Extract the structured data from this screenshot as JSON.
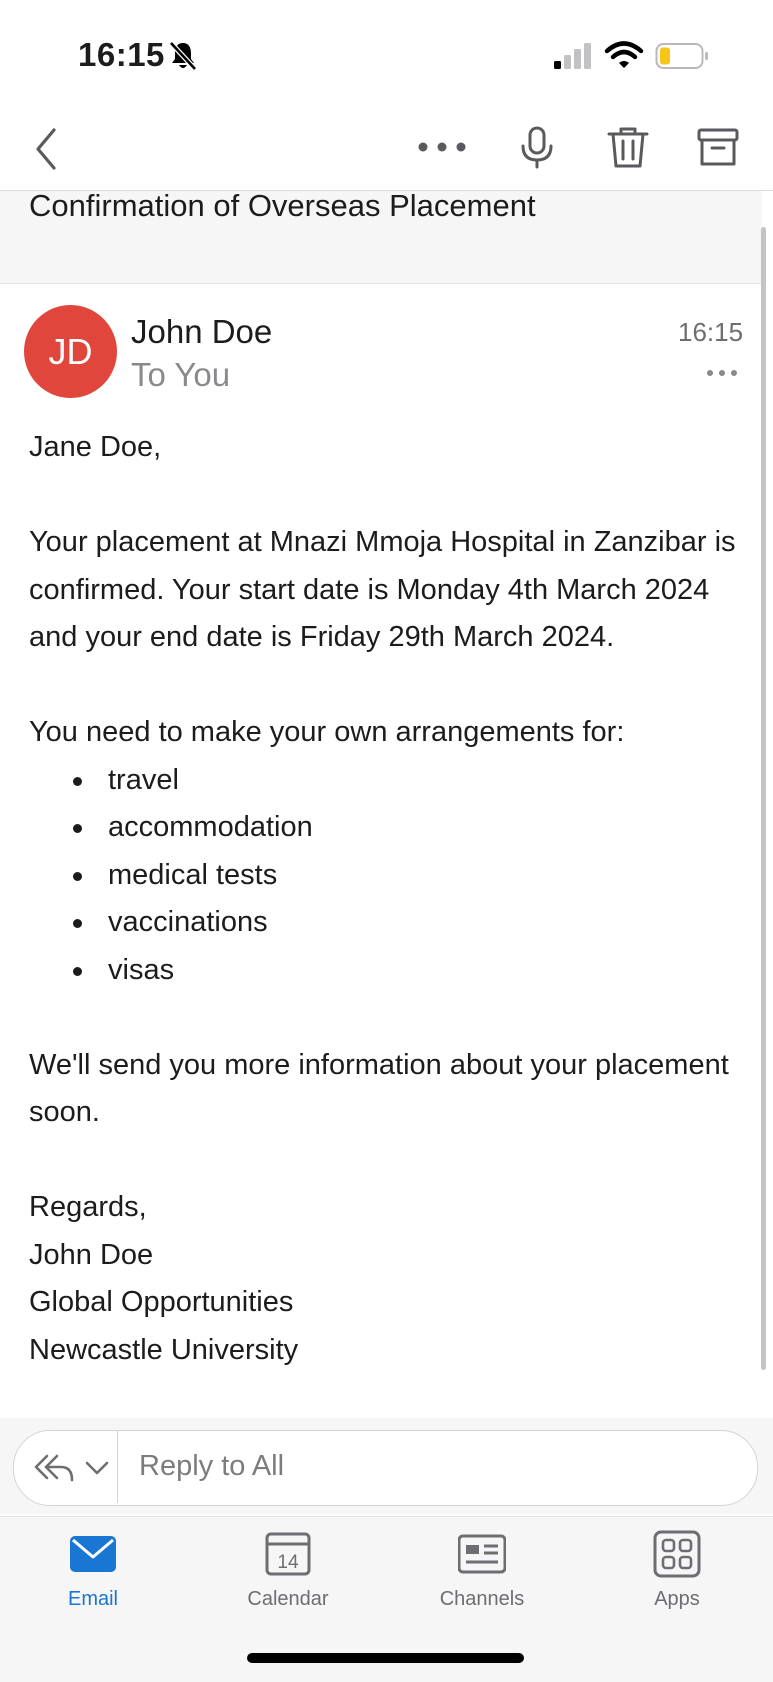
{
  "status_bar": {
    "time": "16:15",
    "icons": [
      "bell-slash-icon",
      "signal-icon",
      "wifi-icon",
      "battery-low-icon"
    ]
  },
  "toolbar": {
    "icons": [
      "chevron-left-icon",
      "more-horizontal-icon",
      "microphone-icon",
      "trash-icon",
      "archive-icon"
    ]
  },
  "message": {
    "subject": "Confirmation of Overseas Placement",
    "avatar_initials": "JD",
    "avatar_color": "#e0463c",
    "sender": "John Doe",
    "recipient": "To You",
    "time": "16:15",
    "body": {
      "greeting": "Jane Doe,",
      "paragraph1": "Your placement at Mnazi Mmoja Hospital in Zanzibar is confirmed. Your start date is Monday 4th March 2024 and your end date is Friday 29th March 2024.",
      "list_intro": "You need to make your own arrangements for:",
      "list_items": [
        "travel",
        "accommodation",
        "medical tests",
        "vaccinations",
        "visas"
      ],
      "paragraph2": "We'll send you more information about your placement soon.",
      "signoff": "Regards,",
      "signature": [
        "John Doe",
        "Global Opportunities",
        "Newcastle University"
      ]
    }
  },
  "reply": {
    "placeholder": "Reply to All"
  },
  "tabs": [
    {
      "label": "Email",
      "icon": "envelope-icon",
      "active": true
    },
    {
      "label": "Calendar",
      "icon": "calendar-icon",
      "day": "14",
      "active": false
    },
    {
      "label": "Channels",
      "icon": "channels-icon",
      "active": false
    },
    {
      "label": "Apps",
      "icon": "apps-grid-icon",
      "active": false
    }
  ],
  "colors": {
    "accent": "#1976d2",
    "avatar": "#e0463c"
  }
}
